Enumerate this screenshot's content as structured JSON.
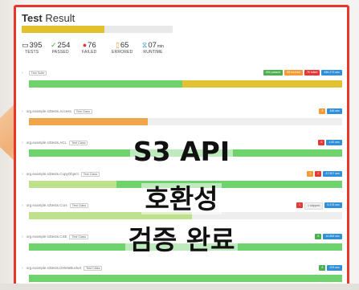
{
  "header": {
    "title_bold": "Test",
    "title_rest": " Result",
    "progress_pct": 55
  },
  "stats": [
    {
      "icon": "folder-icon",
      "glyph": "▭",
      "value": "395",
      "label": "TESTS",
      "color": "#333333"
    },
    {
      "icon": "check-circle-icon",
      "glyph": "✓",
      "value": "254",
      "label": "PASSED",
      "color": "#3fae4c"
    },
    {
      "icon": "error-icon",
      "glyph": "●",
      "value": "76",
      "label": "FAILED",
      "color": "#e53935"
    },
    {
      "icon": "warning-icon",
      "glyph": "▯",
      "value": "65",
      "label": "ERRORED",
      "color": "#f39c36"
    },
    {
      "icon": "hourglass-icon",
      "glyph": "⧖",
      "value": "07",
      "unit": "min",
      "label": "RUNTIME",
      "color": "#2f8fd8"
    }
  ],
  "suite": {
    "name": "Test Suite",
    "pills": [
      "254 passed",
      "65 errored",
      "76 failed",
      "456.273 sec"
    ]
  },
  "rows": [
    {
      "name": "org.example.s3tests.Access",
      "tag": "Test Class",
      "pills": [
        "3",
        "448 sec"
      ]
    },
    {
      "name": "org.example.s3tests.ACL",
      "tag": "Test Class",
      "pills": [
        "6",
        "1.82 sec"
      ]
    },
    {
      "name": "org.example.s3tests.CopyObject",
      "tag": "Test Class",
      "pills": [
        "1",
        "2",
        "47.907 sec"
      ]
    },
    {
      "name": "org.example.s3tests.Cors",
      "tag": "Test Class",
      "pills": [
        "1",
        "1 skipped",
        "5.378 sec"
      ]
    },
    {
      "name": "org.example.s3tests.CSE",
      "tag": "Test Class",
      "pills": [
        "8",
        "10.806 sec"
      ]
    },
    {
      "name": "org.example.s3tests.DeleteBucket",
      "tag": "Test Class",
      "pills": [
        "8",
        "203 sec"
      ]
    }
  ],
  "overlay": {
    "line1": "S3 API",
    "line2": "호환성",
    "line3": "검증 완료"
  }
}
